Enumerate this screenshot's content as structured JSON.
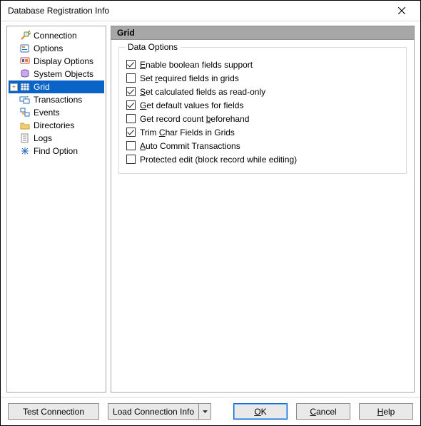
{
  "window": {
    "title": "Database Registration Info"
  },
  "tree": {
    "items": [
      {
        "id": "connection",
        "label": "Connection",
        "icon": "connection",
        "expandable": false
      },
      {
        "id": "options",
        "label": "Options",
        "icon": "options",
        "expandable": false
      },
      {
        "id": "display-options",
        "label": "Display Options",
        "icon": "display",
        "expandable": false
      },
      {
        "id": "system-objects",
        "label": "System Objects",
        "icon": "system",
        "expandable": false
      },
      {
        "id": "grid",
        "label": "Grid",
        "icon": "grid",
        "expandable": true,
        "selected": true
      },
      {
        "id": "transactions",
        "label": "Transactions",
        "icon": "txn",
        "expandable": false
      },
      {
        "id": "events",
        "label": "Events",
        "icon": "events",
        "expandable": false
      },
      {
        "id": "directories",
        "label": "Directories",
        "icon": "folder",
        "expandable": false
      },
      {
        "id": "logs",
        "label": "Logs",
        "icon": "logs",
        "expandable": false
      },
      {
        "id": "find-option",
        "label": "Find Option",
        "icon": "find",
        "expandable": false
      }
    ]
  },
  "content": {
    "header": "Grid",
    "group": {
      "title": "Data Options",
      "options": [
        {
          "id": "enable-bool",
          "label_pre": "",
          "accel": "E",
          "label_post": "nable boolean fields support",
          "checked": true
        },
        {
          "id": "set-required",
          "label_pre": "Set ",
          "accel": "r",
          "label_post": "equired fields in grids",
          "checked": false
        },
        {
          "id": "set-calc-ro",
          "label_pre": "",
          "accel": "S",
          "label_post": "et calculated fields as read-only",
          "checked": true
        },
        {
          "id": "get-default",
          "label_pre": "",
          "accel": "G",
          "label_post": "et default values for fields",
          "checked": true
        },
        {
          "id": "get-count",
          "label_pre": "Get record count ",
          "accel": "b",
          "label_post": "eforehand",
          "checked": false
        },
        {
          "id": "trim-char",
          "label_pre": "Trim ",
          "accel": "C",
          "label_post": "har Fields in Grids",
          "checked": true
        },
        {
          "id": "auto-commit",
          "label_pre": "",
          "accel": "A",
          "label_post": "uto Commit Transactions",
          "checked": false
        },
        {
          "id": "protected",
          "label_pre": "Protected edit (block record while editing)",
          "accel": "",
          "label_post": "",
          "checked": false
        }
      ]
    }
  },
  "footer": {
    "test": "Test Connection",
    "load": "Load Connection Info",
    "ok_pre": "",
    "ok_acc": "O",
    "ok_post": "K",
    "cancel_pre": "",
    "cancel_acc": "C",
    "cancel_post": "ancel",
    "help_pre": "",
    "help_acc": "H",
    "help_post": "elp"
  }
}
